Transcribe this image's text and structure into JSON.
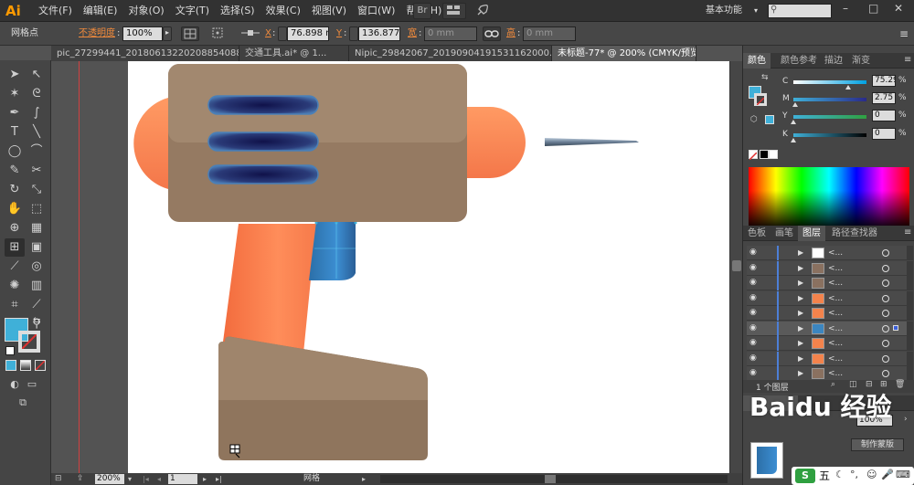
{
  "app": {
    "logo": "Ai"
  },
  "menubar": {
    "items": [
      "文件(F)",
      "编辑(E)",
      "对象(O)",
      "文字(T)",
      "选择(S)",
      "效果(C)",
      "视图(V)",
      "窗口(W)",
      "帮助(H)"
    ],
    "br_label": "Br",
    "workspace": "基本功能",
    "search_placeholder": ""
  },
  "control_bar": {
    "selection_label": "网格点",
    "opacity_label": "不透明度",
    "opacity_value": "100%",
    "x_label": "X",
    "x_value": "76.898 mm",
    "y_label": "Y",
    "y_value": "136.877 mm",
    "w_label": "宽",
    "w_value": "0 mm",
    "h_label": "高",
    "h_value": "0 mm"
  },
  "doc_tabs": [
    {
      "label": "pic_27299441_2018061322020885408​8.ai* @ ...",
      "active": false
    },
    {
      "label": "交通工具.ai* @ 1...",
      "active": false
    },
    {
      "label": "Nipic_29842067_20190904191531162000.ai* ...",
      "active": false
    },
    {
      "label": "未标题-77* @ 200% (CMYK/预览)",
      "active": true
    }
  ],
  "status_bar": {
    "zoom": "200%",
    "page": "1",
    "tool_name": "网格"
  },
  "color_panel": {
    "tabs": [
      "颜色",
      "颜色参考",
      "描边",
      "渐变"
    ],
    "fill_color": "#3fb0d8",
    "channels": [
      {
        "label": "C",
        "value": "75.29",
        "unit": "%",
        "level": 0.75
      },
      {
        "label": "M",
        "value": "2.75",
        "unit": "%",
        "level": 0.03
      },
      {
        "label": "Y",
        "value": "0",
        "unit": "%",
        "level": 0.0
      },
      {
        "label": "K",
        "value": "0",
        "unit": "%",
        "level": 0.0
      }
    ]
  },
  "layers_panel": {
    "tabs": [
      "色板",
      "画笔",
      "图层",
      "路径查找器"
    ],
    "rows": [
      {
        "name": "<...",
        "thumb": "#ffffff",
        "selected": false
      },
      {
        "name": "<...",
        "thumb": "#8a7160",
        "selected": false
      },
      {
        "name": "<...",
        "thumb": "#8a7160",
        "selected": false
      },
      {
        "name": "<...",
        "thumb": "#f4834c",
        "selected": false
      },
      {
        "name": "<...",
        "thumb": "#f4834c",
        "selected": false
      },
      {
        "name": "<...",
        "thumb": "#3c86c0",
        "selected": true
      },
      {
        "name": "<...",
        "thumb": "#f4834c",
        "selected": false
      },
      {
        "name": "<...",
        "thumb": "#f4834c",
        "selected": false
      },
      {
        "name": "<...",
        "thumb": "#8a7160",
        "selected": false
      }
    ],
    "footer": "1 个图层"
  },
  "bottom_panel": {
    "opacity_value": "100%",
    "mode_label": "制作蒙版"
  },
  "watermark": {
    "text": "Baidu 经验"
  },
  "taskbar": {
    "ime": "五"
  }
}
